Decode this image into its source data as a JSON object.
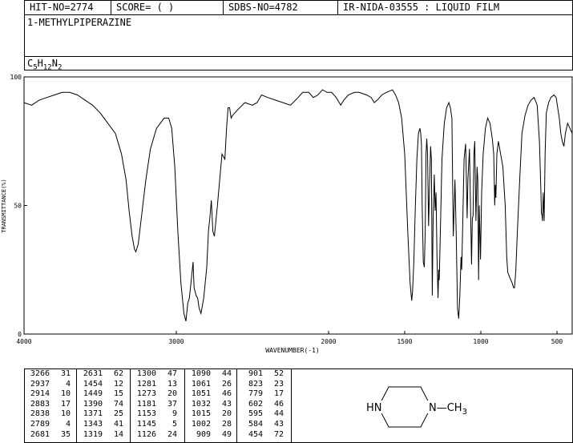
{
  "header": {
    "hit_no": "HIT-NO=2774",
    "score": "SCORE=  (  )",
    "sdbs_no": "SDBS-NO=4782",
    "source": "IR-NIDA-03555 : LIQUID FILM"
  },
  "compound": {
    "name": "1-METHYLPIPERAZINE",
    "formula_c": "C",
    "formula_c_n": "5",
    "formula_h": "H",
    "formula_h_n": "12",
    "formula_n": "N",
    "formula_n_n": "2"
  },
  "structure": {
    "left_label": "HN",
    "right_label": "N—CH",
    "right_sub": "3"
  },
  "chart_data": {
    "type": "line",
    "xlabel": "WAVENUMBER(-1)",
    "ylabel": "TRANSMITTANCE(%)",
    "xlim": [
      4000,
      400
    ],
    "ylim": [
      0,
      100
    ],
    "x_ticks": [
      4000,
      3000,
      2000,
      1500,
      1000,
      500
    ],
    "y_ticks": [
      0,
      50,
      100
    ],
    "grid": false,
    "series": [
      {
        "points": [
          [
            4000,
            90
          ],
          [
            3950,
            89
          ],
          [
            3900,
            91
          ],
          [
            3850,
            92
          ],
          [
            3800,
            93
          ],
          [
            3750,
            94
          ],
          [
            3700,
            94
          ],
          [
            3650,
            93
          ],
          [
            3600,
            91
          ],
          [
            3550,
            89
          ],
          [
            3500,
            86
          ],
          [
            3450,
            82
          ],
          [
            3400,
            78
          ],
          [
            3360,
            70
          ],
          [
            3330,
            60
          ],
          [
            3310,
            48
          ],
          [
            3290,
            38
          ],
          [
            3275,
            33
          ],
          [
            3266,
            32
          ],
          [
            3250,
            35
          ],
          [
            3230,
            45
          ],
          [
            3200,
            60
          ],
          [
            3170,
            72
          ],
          [
            3130,
            80
          ],
          [
            3080,
            84
          ],
          [
            3050,
            84
          ],
          [
            3030,
            80
          ],
          [
            3010,
            65
          ],
          [
            2990,
            40
          ],
          [
            2970,
            20
          ],
          [
            2950,
            8
          ],
          [
            2937,
            5
          ],
          [
            2925,
            12
          ],
          [
            2914,
            14
          ],
          [
            2900,
            22
          ],
          [
            2890,
            28
          ],
          [
            2883,
            18
          ],
          [
            2870,
            15
          ],
          [
            2860,
            14
          ],
          [
            2850,
            10
          ],
          [
            2838,
            8
          ],
          [
            2820,
            14
          ],
          [
            2800,
            26
          ],
          [
            2789,
            40
          ],
          [
            2780,
            45
          ],
          [
            2770,
            52
          ],
          [
            2760,
            40
          ],
          [
            2750,
            38
          ],
          [
            2730,
            50
          ],
          [
            2700,
            70
          ],
          [
            2681,
            68
          ],
          [
            2670,
            80
          ],
          [
            2660,
            88
          ],
          [
            2650,
            88
          ],
          [
            2640,
            84
          ],
          [
            2631,
            85
          ],
          [
            2600,
            87
          ],
          [
            2550,
            90
          ],
          [
            2500,
            89
          ],
          [
            2470,
            90
          ],
          [
            2440,
            93
          ],
          [
            2400,
            92
          ],
          [
            2350,
            91
          ],
          [
            2300,
            90
          ],
          [
            2250,
            89
          ],
          [
            2200,
            92
          ],
          [
            2170,
            94
          ],
          [
            2130,
            94
          ],
          [
            2100,
            92
          ],
          [
            2070,
            93
          ],
          [
            2040,
            95
          ],
          [
            2010,
            94
          ],
          [
            1980,
            94
          ],
          [
            1950,
            92
          ],
          [
            1920,
            89
          ],
          [
            1900,
            91
          ],
          [
            1870,
            93
          ],
          [
            1830,
            94
          ],
          [
            1800,
            94
          ],
          [
            1750,
            93
          ],
          [
            1720,
            92
          ],
          [
            1700,
            90
          ],
          [
            1680,
            91
          ],
          [
            1650,
            93
          ],
          [
            1620,
            94
          ],
          [
            1580,
            95
          ],
          [
            1560,
            93
          ],
          [
            1540,
            90
          ],
          [
            1520,
            84
          ],
          [
            1500,
            70
          ],
          [
            1480,
            40
          ],
          [
            1465,
            20
          ],
          [
            1454,
            13
          ],
          [
            1449,
            16
          ],
          [
            1440,
            28
          ],
          [
            1430,
            50
          ],
          [
            1420,
            68
          ],
          [
            1410,
            78
          ],
          [
            1400,
            80
          ],
          [
            1395,
            78
          ],
          [
            1390,
            74
          ],
          [
            1385,
            50
          ],
          [
            1378,
            28
          ],
          [
            1371,
            26
          ],
          [
            1365,
            40
          ],
          [
            1360,
            70
          ],
          [
            1355,
            76
          ],
          [
            1350,
            70
          ],
          [
            1343,
            42
          ],
          [
            1338,
            55
          ],
          [
            1330,
            73
          ],
          [
            1325,
            68
          ],
          [
            1319,
            15
          ],
          [
            1313,
            45
          ],
          [
            1306,
            62
          ],
          [
            1300,
            48
          ],
          [
            1294,
            55
          ],
          [
            1288,
            30
          ],
          [
            1281,
            14
          ],
          [
            1277,
            25
          ],
          [
            1273,
            21
          ],
          [
            1266,
            40
          ],
          [
            1255,
            68
          ],
          [
            1240,
            82
          ],
          [
            1225,
            88
          ],
          [
            1210,
            90
          ],
          [
            1200,
            88
          ],
          [
            1190,
            84
          ],
          [
            1181,
            38
          ],
          [
            1175,
            50
          ],
          [
            1170,
            60
          ],
          [
            1162,
            40
          ],
          [
            1153,
            10
          ],
          [
            1145,
            6
          ],
          [
            1138,
            15
          ],
          [
            1130,
            30
          ],
          [
            1126,
            25
          ],
          [
            1120,
            40
          ],
          [
            1110,
            68
          ],
          [
            1100,
            74
          ],
          [
            1095,
            60
          ],
          [
            1090,
            45
          ],
          [
            1085,
            60
          ],
          [
            1075,
            72
          ],
          [
            1068,
            50
          ],
          [
            1061,
            27
          ],
          [
            1056,
            45
          ],
          [
            1051,
            46
          ],
          [
            1045,
            70
          ],
          [
            1040,
            75
          ],
          [
            1032,
            44
          ],
          [
            1025,
            65
          ],
          [
            1020,
            60
          ],
          [
            1015,
            21
          ],
          [
            1010,
            50
          ],
          [
            1002,
            29
          ],
          [
            995,
            55
          ],
          [
            985,
            70
          ],
          [
            970,
            80
          ],
          [
            955,
            84
          ],
          [
            940,
            82
          ],
          [
            925,
            76
          ],
          [
            915,
            70
          ],
          [
            909,
            50
          ],
          [
            905,
            58
          ],
          [
            901,
            53
          ],
          [
            895,
            70
          ],
          [
            885,
            75
          ],
          [
            870,
            70
          ],
          [
            855,
            65
          ],
          [
            840,
            50
          ],
          [
            830,
            30
          ],
          [
            823,
            24
          ],
          [
            810,
            22
          ],
          [
            795,
            20
          ],
          [
            785,
            18
          ],
          [
            779,
            18
          ],
          [
            770,
            25
          ],
          [
            760,
            40
          ],
          [
            745,
            60
          ],
          [
            730,
            78
          ],
          [
            710,
            85
          ],
          [
            690,
            89
          ],
          [
            670,
            91
          ],
          [
            650,
            92
          ],
          [
            630,
            89
          ],
          [
            615,
            75
          ],
          [
            605,
            55
          ],
          [
            602,
            47
          ],
          [
            598,
            46
          ],
          [
            595,
            44
          ],
          [
            590,
            55
          ],
          [
            584,
            44
          ],
          [
            578,
            70
          ],
          [
            570,
            86
          ],
          [
            555,
            90
          ],
          [
            540,
            92
          ],
          [
            520,
            93
          ],
          [
            505,
            92
          ],
          [
            495,
            88
          ],
          [
            485,
            84
          ],
          [
            475,
            78
          ],
          [
            465,
            75
          ],
          [
            454,
            73
          ],
          [
            445,
            78
          ],
          [
            430,
            82
          ],
          [
            415,
            80
          ],
          [
            400,
            78
          ]
        ]
      }
    ]
  },
  "peaks": [
    [
      [
        "3266",
        "31"
      ],
      [
        "2937",
        "4"
      ],
      [
        "2914",
        "10"
      ],
      [
        "2883",
        "17"
      ],
      [
        "2838",
        "10"
      ],
      [
        "2789",
        "4"
      ],
      [
        "2681",
        "35"
      ]
    ],
    [
      [
        "2631",
        "62"
      ],
      [
        "1454",
        "12"
      ],
      [
        "1449",
        "15"
      ],
      [
        "1390",
        "74"
      ],
      [
        "1371",
        "25"
      ],
      [
        "1343",
        "41"
      ],
      [
        "1319",
        "14"
      ]
    ],
    [
      [
        "1300",
        "47"
      ],
      [
        "1281",
        "13"
      ],
      [
        "1273",
        "20"
      ],
      [
        "1181",
        "37"
      ],
      [
        "1153",
        "9"
      ],
      [
        "1145",
        "5"
      ],
      [
        "1126",
        "24"
      ]
    ],
    [
      [
        "1090",
        "44"
      ],
      [
        "1061",
        "26"
      ],
      [
        "1051",
        "46"
      ],
      [
        "1032",
        "43"
      ],
      [
        "1015",
        "20"
      ],
      [
        "1002",
        "28"
      ],
      [
        "909",
        "49"
      ]
    ],
    [
      [
        "901",
        "52"
      ],
      [
        "823",
        "23"
      ],
      [
        "779",
        "17"
      ],
      [
        "602",
        "46"
      ],
      [
        "595",
        "44"
      ],
      [
        "584",
        "43"
      ],
      [
        "454",
        "72"
      ]
    ]
  ]
}
